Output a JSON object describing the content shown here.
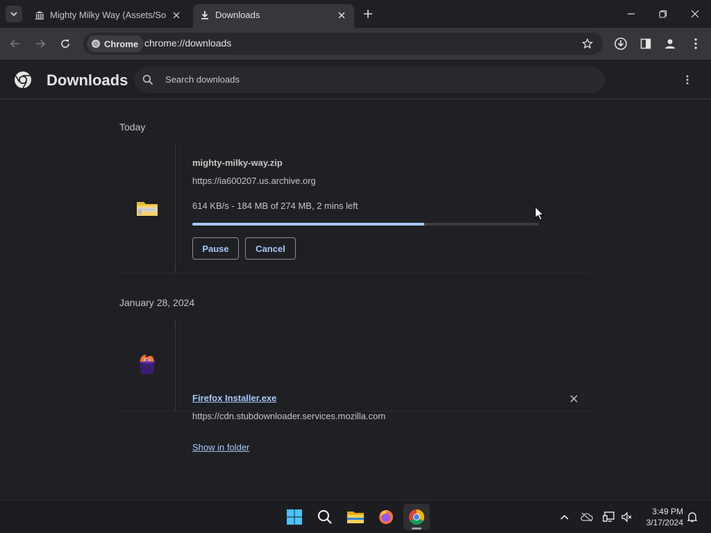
{
  "tabs": [
    {
      "title": "Mighty Milky Way (Assets/Soun",
      "icon": "museum-icon"
    },
    {
      "title": "Downloads",
      "icon": "download-icon"
    }
  ],
  "omnibox": {
    "chip": "Chrome",
    "url": "chrome://downloads"
  },
  "page": {
    "title": "Downloads",
    "search_placeholder": "Search downloads"
  },
  "groups": [
    {
      "date": "Today",
      "item": {
        "name": "mighty-milky-way.zip",
        "url": "https://ia600207.us.archive.org",
        "status": "614 KB/s - 184 MB of 274 MB, 2 mins left",
        "progress": 0.67,
        "buttons": [
          "Pause",
          "Cancel"
        ],
        "icon": "zip-folder-icon"
      }
    },
    {
      "date": "January 28, 2024",
      "item": {
        "name": "Firefox Installer.exe",
        "url": "https://cdn.stubdownloader.services.mozilla.com",
        "link": "Show in folder",
        "icon": "firefox-installer-icon"
      }
    }
  ],
  "taskbar": {
    "apps": [
      "windows-start-icon",
      "search-icon",
      "file-explorer-icon",
      "firefox-icon",
      "chrome-icon"
    ],
    "time": "3:49 PM",
    "date": "3/17/2024"
  },
  "colors": {
    "accent": "#a8c7fa",
    "background": "#1f2023",
    "toolbar": "#36373a"
  }
}
